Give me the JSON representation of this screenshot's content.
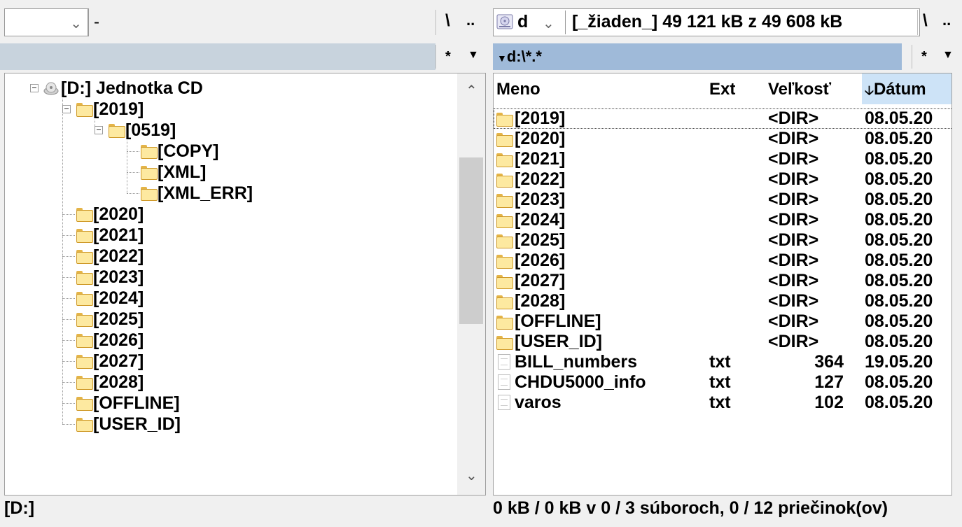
{
  "left_panel": {
    "drive_value": "",
    "drive_info": "-",
    "root_btn": "\\",
    "up_btn": "..",
    "filter_btn": "*",
    "status": "[D:]",
    "tree": [
      {
        "label": "[D:]  Jednotka CD",
        "depth": 0,
        "icon": "cd-drive-icon",
        "expanded": true
      },
      {
        "label": "[2019]",
        "depth": 1,
        "icon": "folder-icon",
        "expanded": true
      },
      {
        "label": "[0519]",
        "depth": 2,
        "icon": "folder-icon",
        "expanded": true
      },
      {
        "label": "[COPY]",
        "depth": 3,
        "icon": "folder-icon"
      },
      {
        "label": "[XML]",
        "depth": 3,
        "icon": "folder-icon"
      },
      {
        "label": "[XML_ERR]",
        "depth": 3,
        "icon": "folder-icon"
      },
      {
        "label": "[2020]",
        "depth": 1,
        "icon": "folder-icon"
      },
      {
        "label": "[2021]",
        "depth": 1,
        "icon": "folder-icon"
      },
      {
        "label": "[2022]",
        "depth": 1,
        "icon": "folder-icon"
      },
      {
        "label": "[2023]",
        "depth": 1,
        "icon": "folder-icon"
      },
      {
        "label": "[2024]",
        "depth": 1,
        "icon": "folder-icon"
      },
      {
        "label": "[2025]",
        "depth": 1,
        "icon": "folder-icon"
      },
      {
        "label": "[2026]",
        "depth": 1,
        "icon": "folder-icon"
      },
      {
        "label": "[2027]",
        "depth": 1,
        "icon": "folder-icon"
      },
      {
        "label": "[2028]",
        "depth": 1,
        "icon": "folder-icon"
      },
      {
        "label": "[OFFLINE]",
        "depth": 1,
        "icon": "folder-icon"
      },
      {
        "label": "[USER_ID]",
        "depth": 1,
        "icon": "folder-icon"
      }
    ]
  },
  "right_panel": {
    "drive_value": "d",
    "drive_info": "[_žiaden_]  49 121 kB z 49 608 kB",
    "root_btn": "\\",
    "up_btn": "..",
    "path": "d:\\*.*",
    "filter_btn": "*",
    "columns": {
      "name": "Meno",
      "ext": "Ext",
      "size": "Veľkosť",
      "date": "Dátum"
    },
    "sort_column": "date",
    "files": [
      {
        "name": "[2019]",
        "ext": "",
        "size": "<DIR>",
        "date": "08.05.20",
        "type": "dir",
        "focused": true
      },
      {
        "name": "[2020]",
        "ext": "",
        "size": "<DIR>",
        "date": "08.05.20",
        "type": "dir"
      },
      {
        "name": "[2021]",
        "ext": "",
        "size": "<DIR>",
        "date": "08.05.20",
        "type": "dir"
      },
      {
        "name": "[2022]",
        "ext": "",
        "size": "<DIR>",
        "date": "08.05.20",
        "type": "dir"
      },
      {
        "name": "[2023]",
        "ext": "",
        "size": "<DIR>",
        "date": "08.05.20",
        "type": "dir"
      },
      {
        "name": "[2024]",
        "ext": "",
        "size": "<DIR>",
        "date": "08.05.20",
        "type": "dir"
      },
      {
        "name": "[2025]",
        "ext": "",
        "size": "<DIR>",
        "date": "08.05.20",
        "type": "dir"
      },
      {
        "name": "[2026]",
        "ext": "",
        "size": "<DIR>",
        "date": "08.05.20",
        "type": "dir"
      },
      {
        "name": "[2027]",
        "ext": "",
        "size": "<DIR>",
        "date": "08.05.20",
        "type": "dir"
      },
      {
        "name": "[2028]",
        "ext": "",
        "size": "<DIR>",
        "date": "08.05.20",
        "type": "dir"
      },
      {
        "name": "[OFFLINE]",
        "ext": "",
        "size": "<DIR>",
        "date": "08.05.20",
        "type": "dir"
      },
      {
        "name": "[USER_ID]",
        "ext": "",
        "size": "<DIR>",
        "date": "08.05.20",
        "type": "dir"
      },
      {
        "name": "BILL_numbers",
        "ext": "txt",
        "size": "364",
        "date": "19.05.20",
        "type": "file"
      },
      {
        "name": "CHDU5000_info",
        "ext": "txt",
        "size": "127",
        "date": "08.05.20",
        "type": "file"
      },
      {
        "name": "varos",
        "ext": "txt",
        "size": "102",
        "date": "08.05.20",
        "type": "file"
      }
    ],
    "status": "0 kB / 0 kB v 0 / 3 súboroch, 0 / 12 priečinok(ov)"
  },
  "colors": {
    "left_path_bar": "#c8d3dd",
    "right_path_bar": "#9fbad9",
    "sorted_header": "#cde3f7",
    "folder_fill": "#fde9a0"
  }
}
